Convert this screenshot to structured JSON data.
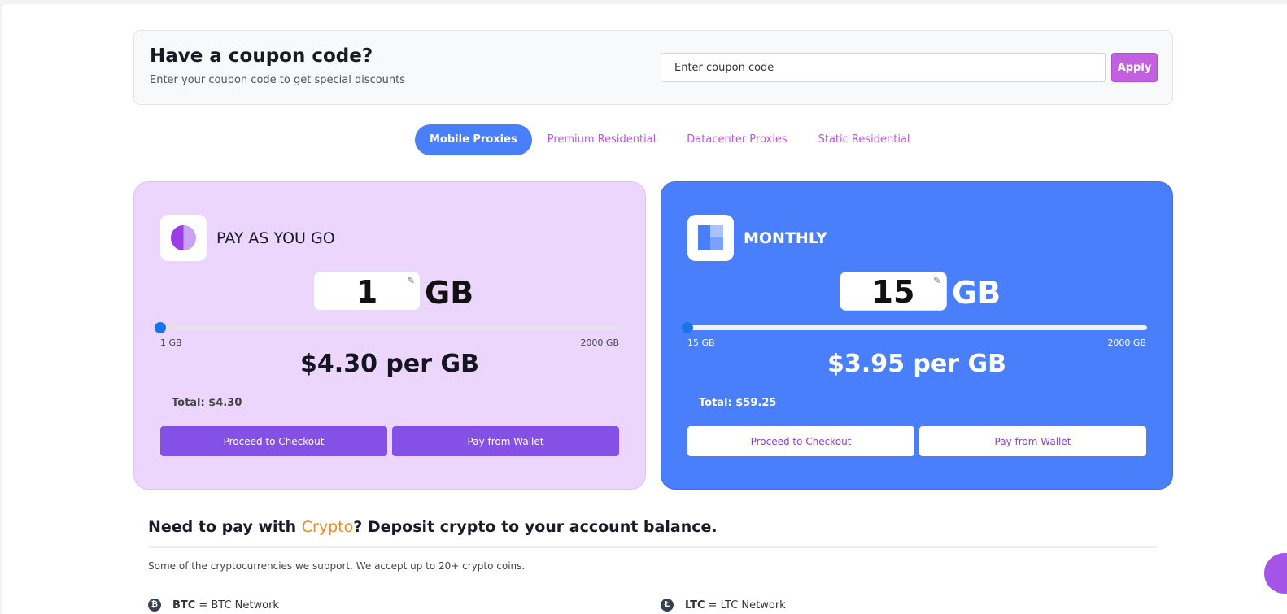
{
  "coupon": {
    "title": "Have a coupon code?",
    "subtitle": "Enter your coupon code to get special discounts",
    "placeholder": "Enter coupon code",
    "apply_label": "Apply"
  },
  "tabs": [
    {
      "label": "Mobile Proxies",
      "active": true
    },
    {
      "label": "Premium Residential",
      "active": false
    },
    {
      "label": "Datacenter Proxies",
      "active": false
    },
    {
      "label": "Static Residential",
      "active": false
    }
  ],
  "plans": {
    "payg": {
      "name": "PAY AS YOU GO",
      "gb_value": "1",
      "gb_unit": "GB",
      "slider_min": "1 GB",
      "slider_max": "2000 GB",
      "slider_progress": 0,
      "price": "$4.30 per GB",
      "total": "Total: $4.30",
      "checkout_label": "Proceed to Checkout",
      "wallet_label": "Pay from Wallet"
    },
    "monthly": {
      "name": "MONTHLY",
      "gb_value": "15",
      "gb_unit": "GB",
      "slider_min": "15 GB",
      "slider_max": "2000 GB",
      "slider_progress": 0,
      "price": "$3.95 per GB",
      "total": "Total: $59.25",
      "checkout_label": "Proceed to Checkout",
      "wallet_label": "Pay from Wallet"
    }
  },
  "crypto": {
    "title_prefix": "Need to pay with ",
    "title_accent": "Crypto",
    "title_suffix": "? Deposit crypto to your account balance.",
    "subtitle": "Some of the cryptocurrencies we support. We accept up to 20+ crypto coins.",
    "coins": [
      {
        "symbol": "BTC",
        "network": "= BTC Network",
        "icon": "bitcoin-icon"
      },
      {
        "symbol": "LTC",
        "network": "= LTC Network",
        "icon": "litecoin-icon"
      }
    ]
  },
  "colors": {
    "accent_blue": "#4a7ffb",
    "accent_purple": "#c261e0",
    "payg_bg": "#ecd6fc",
    "button_purple": "#8450e6",
    "crypto_orange": "#f08a1a"
  }
}
